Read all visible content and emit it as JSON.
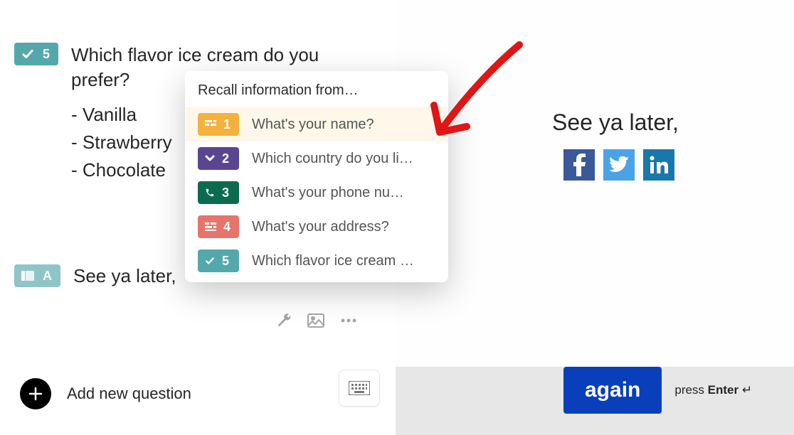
{
  "q5": {
    "number": "5",
    "text": "Which flavor ice cream do you prefer?",
    "options": [
      "Vanilla",
      "Strawberry",
      "Chocolate"
    ]
  },
  "syl": {
    "badge": "A",
    "text": "See ya later,"
  },
  "popover": {
    "title": "Recall information from…",
    "items": [
      {
        "num": "1",
        "label": "What's your name?"
      },
      {
        "num": "2",
        "label": "Which country do you li…"
      },
      {
        "num": "3",
        "label": "What's your phone nu…"
      },
      {
        "num": "4",
        "label": "What's your address?"
      },
      {
        "num": "5",
        "label": "Which flavor ice cream …"
      }
    ]
  },
  "add_question": "Add new question",
  "right": {
    "title": "See ya later,"
  },
  "again": {
    "label": "again",
    "press": "press",
    "enter": "Enter"
  }
}
